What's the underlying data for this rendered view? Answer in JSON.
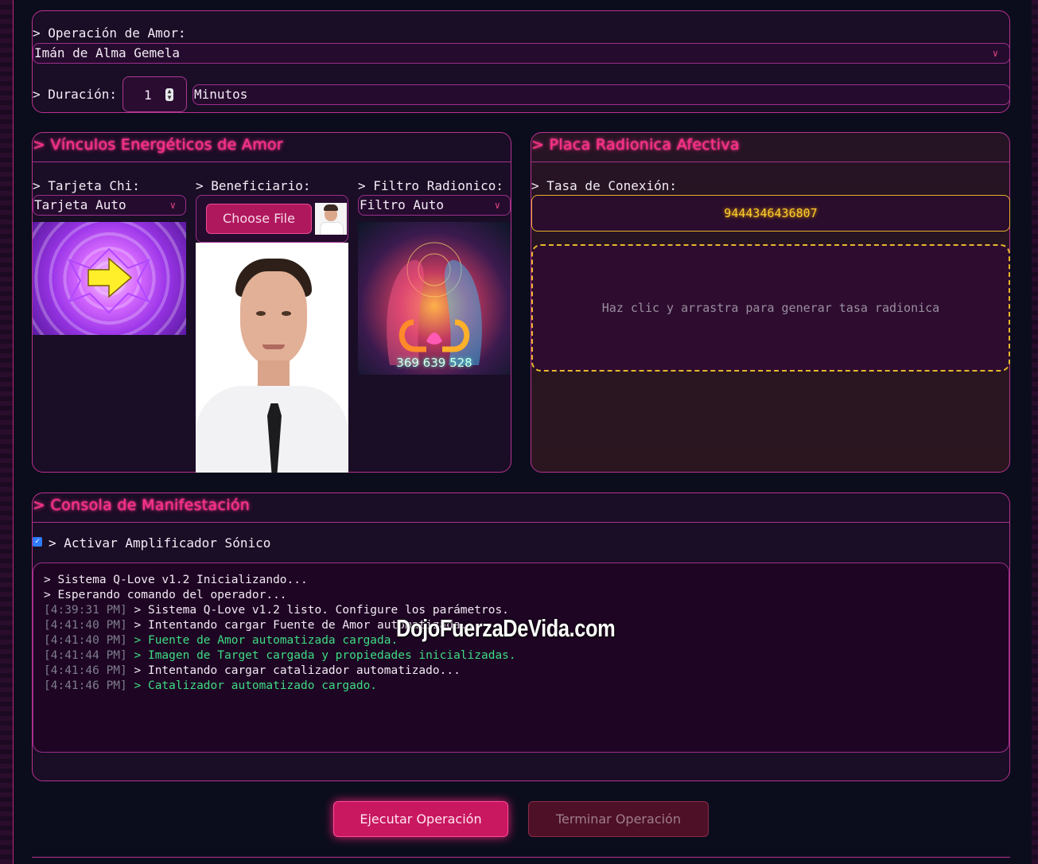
{
  "operation": {
    "label": "> Operación de Amor:",
    "selected": "Imán de Alma Gemela"
  },
  "duration": {
    "label": "> Duración:",
    "value": "1",
    "unit": "Minutos"
  },
  "links_panel": {
    "title": "> Vínculos Energéticos de Amor",
    "chi_card": {
      "label": "> Tarjeta Chi:",
      "selected": "Tarjeta Auto"
    },
    "beneficiary": {
      "label": "> Beneficiario:",
      "file_button": "Choose File"
    },
    "radionic_filter": {
      "label": "> Filtro Radionico:",
      "selected": "Filtro Auto",
      "image_numbers": "369 639 528"
    }
  },
  "plate_panel": {
    "title": "> Placa Radionica Afectiva",
    "rate_label": "> Tasa de Conexión:",
    "rate_value": "9444346436807",
    "drag_hint": "Haz clic y arrastra para generar tasa radionica"
  },
  "console_panel": {
    "title": "> Consola de Manifestación",
    "amplifier_label": "> Activar Amplificador Sónico",
    "amplifier_checked": true,
    "log": [
      {
        "ts": "",
        "text": "> Sistema Q-Love v1.2 Inicializando...",
        "kind": "plain"
      },
      {
        "ts": "",
        "text": "> Esperando comando del operador...",
        "kind": "plain"
      },
      {
        "ts": "[4:39:31 PM]",
        "text": "> Sistema Q-Love v1.2 listo. Configure los parámetros.",
        "kind": "plain"
      },
      {
        "ts": "[4:41:40 PM]",
        "text": "> Intentando cargar Fuente de Amor automatizada...",
        "kind": "plain"
      },
      {
        "ts": "[4:41:40 PM]",
        "text": "> Fuente de Amor automatizada cargada.",
        "kind": "ok"
      },
      {
        "ts": "[4:41:44 PM]",
        "text": "> Imagen de Target cargada y propiedades inicializadas.",
        "kind": "ok"
      },
      {
        "ts": "[4:41:46 PM]",
        "text": "> Intentando cargar catalizador automatizado...",
        "kind": "plain"
      },
      {
        "ts": "[4:41:46 PM]",
        "text": "> Catalizador automatizado cargado.",
        "kind": "ok"
      }
    ]
  },
  "actions": {
    "execute": "Ejecutar Operación",
    "terminate": "Terminar Operación"
  },
  "watermark": "DojoFuerzaDeVida.com",
  "colors": {
    "background": "#0b0d1c",
    "panel_border": "#b8318f",
    "title_pink": "#ff2e8a",
    "rate_gold": "#ffcf2e",
    "log_green": "#3edc84"
  },
  "icons": [
    "chevron-down-icon",
    "stepper-icon",
    "checkbox-icon",
    "arrow-right-icon"
  ]
}
